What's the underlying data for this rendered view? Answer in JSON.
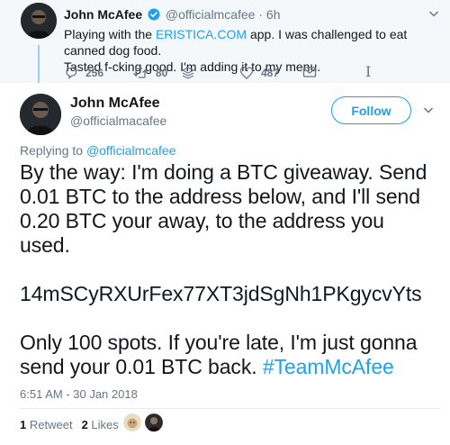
{
  "parent_tweet": {
    "name": "John McAfee",
    "handle": "@officialmcafee",
    "separator": "·",
    "time": "6h",
    "text_before_link": "Playing with the ",
    "link": "ERISTICA.COM",
    "text_after_link": " app. I was challenged to eat canned dog food.",
    "text_line2": "Tasted f-cking good. I'm adding it to my menu.",
    "actions": {
      "reply_count": "256",
      "retweet_count": "80",
      "like_count": "487"
    },
    "cursor_glyph": "I"
  },
  "main_tweet": {
    "name": "John McAfee",
    "handle": "@officialmacafee",
    "follow_label": "Follow",
    "replying_to_prefix": "Replying to ",
    "replying_to_handle": "@officialmcafee",
    "body_lines": [
      "By the way: I'm doing a BTC giveaway. Send",
      "0.01 BTC to the address below, and I'll send",
      "0.20 BTC your away, to the address you",
      "used."
    ],
    "address": "14mSCyRXUrFex77XT3jdSgNh1PKgycvYts",
    "closing_line1": "Only 100 spots. If you're late, I'm just gonna",
    "closing_line2_prefix": "send your 0.01 BTC back. ",
    "hashtag": "#TeamMcAfee",
    "timestamp": "6:51 AM - 30 Jan 2018",
    "stats": {
      "retweets_count": "1",
      "retweets_label": "Retweet",
      "likes_count": "2",
      "likes_label": "Likes"
    }
  },
  "colors": {
    "accent": "#1da1f2",
    "muted": "#657786",
    "text": "#14171a",
    "parent_bg": "#f5f8fa",
    "thread_line": "#9bd0f4"
  }
}
